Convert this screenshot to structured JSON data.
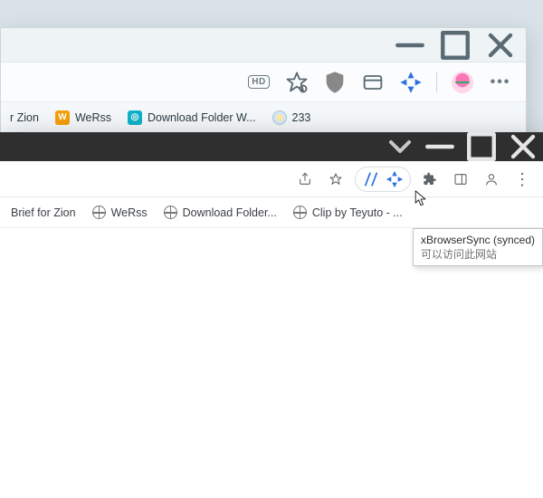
{
  "back_window": {
    "bookmarks": [
      {
        "label": "r Zion"
      },
      {
        "label": "WeRss"
      },
      {
        "label": "Download Folder W..."
      },
      {
        "label": "233"
      }
    ]
  },
  "front_window": {
    "bookmarks": [
      {
        "label": "Brief for Zion"
      },
      {
        "label": "WeRss"
      },
      {
        "label": "Download Folder..."
      },
      {
        "label": "Clip by Teyuto - ..."
      }
    ]
  },
  "tooltip": {
    "title": "xBrowserSync (synced)",
    "subtitle": "可以访问此网站"
  },
  "icons": {
    "hd": "HD"
  }
}
